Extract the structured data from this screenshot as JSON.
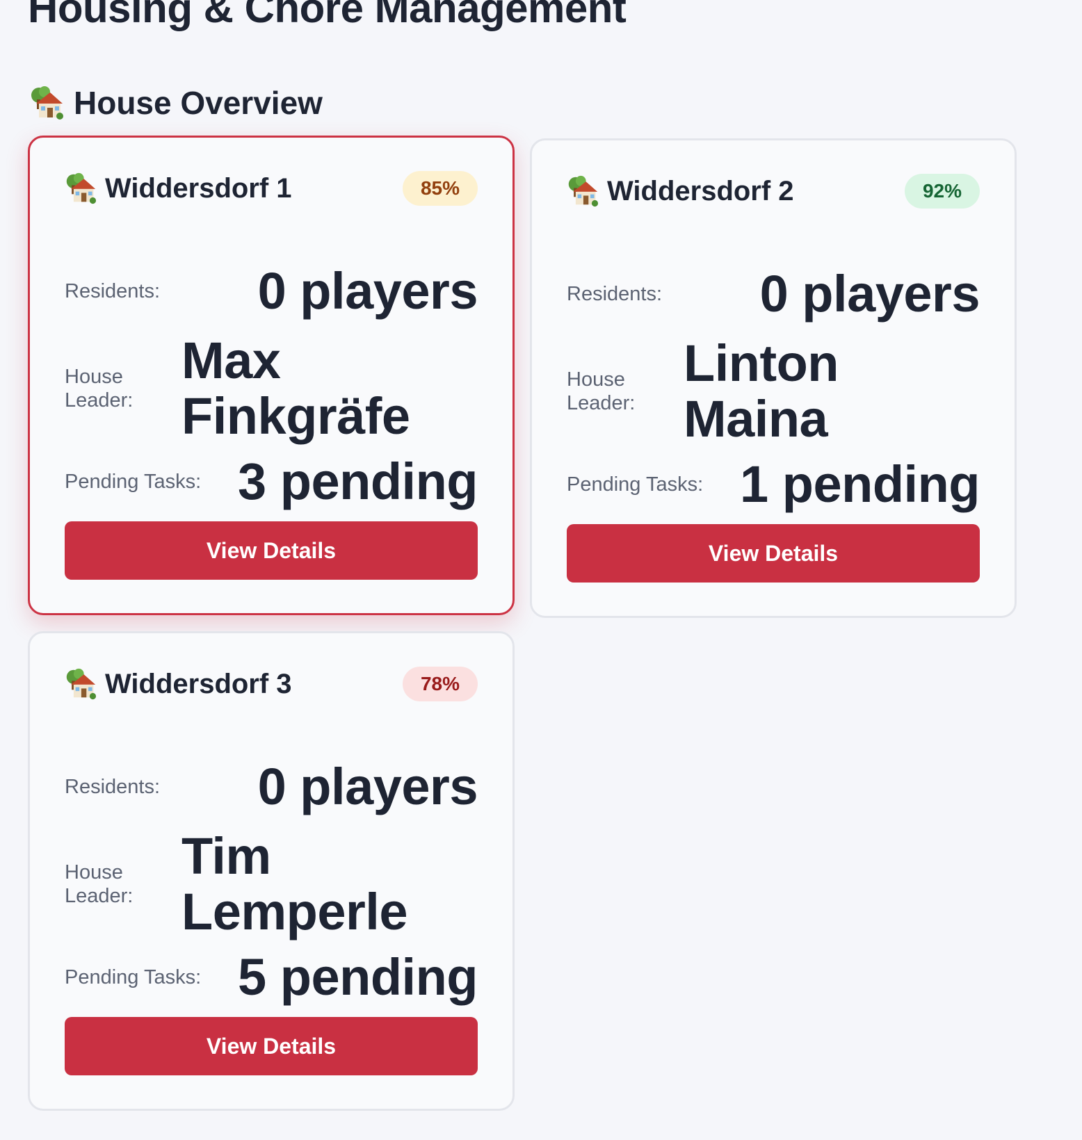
{
  "page": {
    "title": "Housing & Chore Management"
  },
  "section": {
    "icon": "house-with-garden-icon",
    "title": "House Overview"
  },
  "houses": [
    {
      "name": "Widdersdorf 1",
      "icon": "house-with-garden-icon",
      "score": "85%",
      "score_status": "warning",
      "selected": true,
      "residents_label": "Residents:",
      "residents_value": "0 players",
      "leader_label": "House Leader:",
      "leader_value": "Max Finkgräfe",
      "pending_label": "Pending Tasks:",
      "pending_value": "3 pending",
      "button_label": "View Details"
    },
    {
      "name": "Widdersdorf 2",
      "icon": "house-with-garden-icon",
      "score": "92%",
      "score_status": "good",
      "selected": false,
      "residents_label": "Residents:",
      "residents_value": "0 players",
      "leader_label": "House Leader:",
      "leader_value": "Linton Maina",
      "pending_label": "Pending Tasks:",
      "pending_value": "1 pending",
      "button_label": "View Details"
    },
    {
      "name": "Widdersdorf 3",
      "icon": "house-with-garden-icon",
      "score": "78%",
      "score_status": "bad",
      "selected": false,
      "residents_label": "Residents:",
      "residents_value": "0 players",
      "leader_label": "House Leader:",
      "leader_value": "Tim Lemperle",
      "pending_label": "Pending Tasks:",
      "pending_value": "5 pending",
      "button_label": "View Details"
    }
  ],
  "colors": {
    "background": "#f5f6fa",
    "accent": "#c93042",
    "text": "#1e2433",
    "muted_text": "#5b6272",
    "badge_warning_bg": "#fdf1cf",
    "badge_warning_fg": "#92400e",
    "badge_good_bg": "#d9f5e3",
    "badge_good_fg": "#166534",
    "badge_bad_bg": "#fbe0e0",
    "badge_bad_fg": "#991b1b"
  }
}
